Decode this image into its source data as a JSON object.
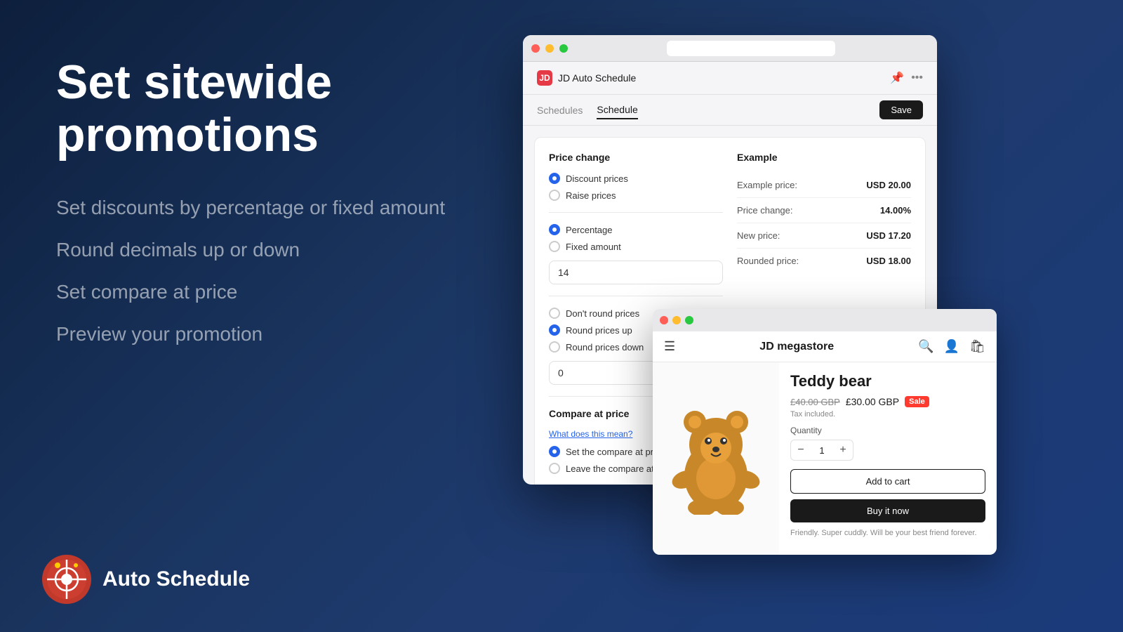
{
  "background": {
    "gradient_start": "#0d1f3c",
    "gradient_end": "#1a3a7a"
  },
  "left_panel": {
    "main_title": "Set sitewide promotions",
    "features": [
      "Set discounts by percentage or fixed amount",
      "Round decimals up or down",
      "Set compare at price",
      "Preview your promotion"
    ]
  },
  "logo": {
    "name": "Auto Schedule"
  },
  "app_window": {
    "title": "JD Auto Schedule",
    "nav": {
      "schedules_label": "Schedules",
      "schedule_label": "Schedule",
      "save_label": "Save"
    },
    "price_change": {
      "section_title": "Price change",
      "options": [
        {
          "label": "Discount prices",
          "checked": true
        },
        {
          "label": "Raise prices",
          "checked": false
        }
      ],
      "type_options": [
        {
          "label": "Percentage",
          "checked": true
        },
        {
          "label": "Fixed amount",
          "checked": false
        }
      ],
      "value": "14",
      "rounding_options": [
        {
          "label": "Don't round prices",
          "checked": false
        },
        {
          "label": "Round prices up",
          "checked": true
        },
        {
          "label": "Round prices down",
          "checked": false
        }
      ],
      "rounding_value": "0"
    },
    "example": {
      "section_title": "Example",
      "rows": [
        {
          "label": "Example price:",
          "value": "USD 20.00"
        },
        {
          "label": "Price change:",
          "value": "14.00%"
        },
        {
          "label": "New price:",
          "value": "USD 17.20"
        },
        {
          "label": "Rounded price:",
          "value": "USD 18.00"
        }
      ]
    },
    "compare_at_price": {
      "section_title": "Compare at price",
      "link_text": "What does this mean?",
      "options": [
        {
          "label": "Set the compare at price to",
          "checked": true
        },
        {
          "label": "Leave the compare at price",
          "checked": false
        }
      ]
    }
  },
  "store_window": {
    "store_name": "JD megastore",
    "product": {
      "name": "Teddy bear",
      "original_price": "£40.00 GBP",
      "new_price": "£30.00 GBP",
      "badge": "Sale",
      "tax_text": "Tax included.",
      "quantity_label": "Quantity",
      "quantity": "1",
      "add_to_cart": "Add to cart",
      "buy_now": "Buy it now",
      "description": "Friendly. Super cuddly. Will be your best friend forever."
    }
  }
}
